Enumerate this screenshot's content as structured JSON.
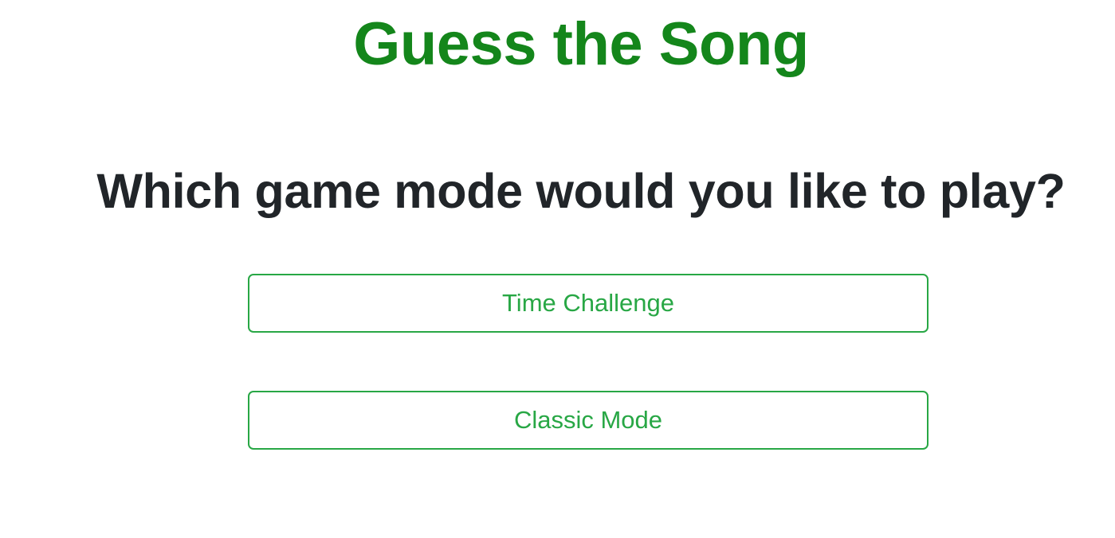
{
  "header": {
    "title": "Guess the Song",
    "title_color": "#14861b"
  },
  "main": {
    "question": "Which game mode would you like to play?",
    "question_color": "#212529",
    "modes": [
      {
        "label": "Time Challenge"
      },
      {
        "label": "Classic Mode"
      }
    ],
    "button_accent_color": "#28a745"
  }
}
